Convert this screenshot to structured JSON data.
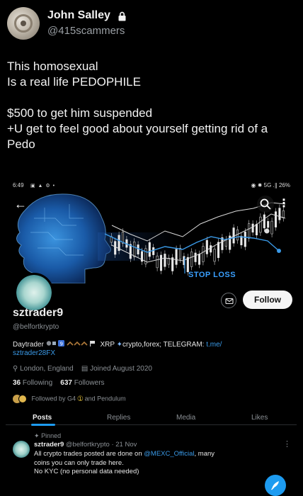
{
  "tweet": {
    "author_name": "John Salley",
    "author_handle": "@415scammers",
    "lines": [
      "This homosexual",
      "Is a real life PEDOPHILE",
      "",
      "$500 to get him suspended",
      "+U get to feel good about yourself getting rid of a",
      "Pedo"
    ]
  },
  "embedded_screenshot": {
    "status_bar": {
      "time": "6:49",
      "left_icons": "▣ ▲ ⚙ •",
      "right": "◉ ✹ 5G .∥ 26%"
    },
    "banner": {
      "overlay_text": "STOP LOSS",
      "back_glyph": "←",
      "more_glyph": "⋮"
    },
    "profile": {
      "name": "sztrader9",
      "handle": "@belfortkrypto",
      "bio_line1_prefix": "Daytrader ",
      "bio_line1_middle": " XRP ",
      "bio_line1_suffix": "crypto,forex; TELEGRAM: ",
      "bio_link_part1": "t.me/",
      "bio_link_part2": "sztrader28FX",
      "location": "London, England",
      "joined": "Joined August 2020",
      "following_count": "36",
      "following_label": "Following",
      "followers_count": "637",
      "followers_label": "Followers",
      "followed_by": "Followed by G4",
      "followed_by_suffix": "and Pendulum",
      "follow_button": "Follow"
    },
    "tabs": [
      "Posts",
      "Replies",
      "Media",
      "Likes"
    ],
    "pinned_post": {
      "pinned_label": "Pinned",
      "author": "sztrader9",
      "handle_date": "@belfortkrypto · 21 Nov",
      "text_before_mention": "All crypto trades posted are done on ",
      "mention": "@MEXC_Official",
      "text_after_mention": ", many",
      "line2": "coins you can only trade here.",
      "line3": "No KYC (no personal data needed)"
    }
  },
  "colors": {
    "accent": "#1d9bf0",
    "link": "#3a9ae8",
    "muted": "#8b9095",
    "background": "#000000"
  }
}
